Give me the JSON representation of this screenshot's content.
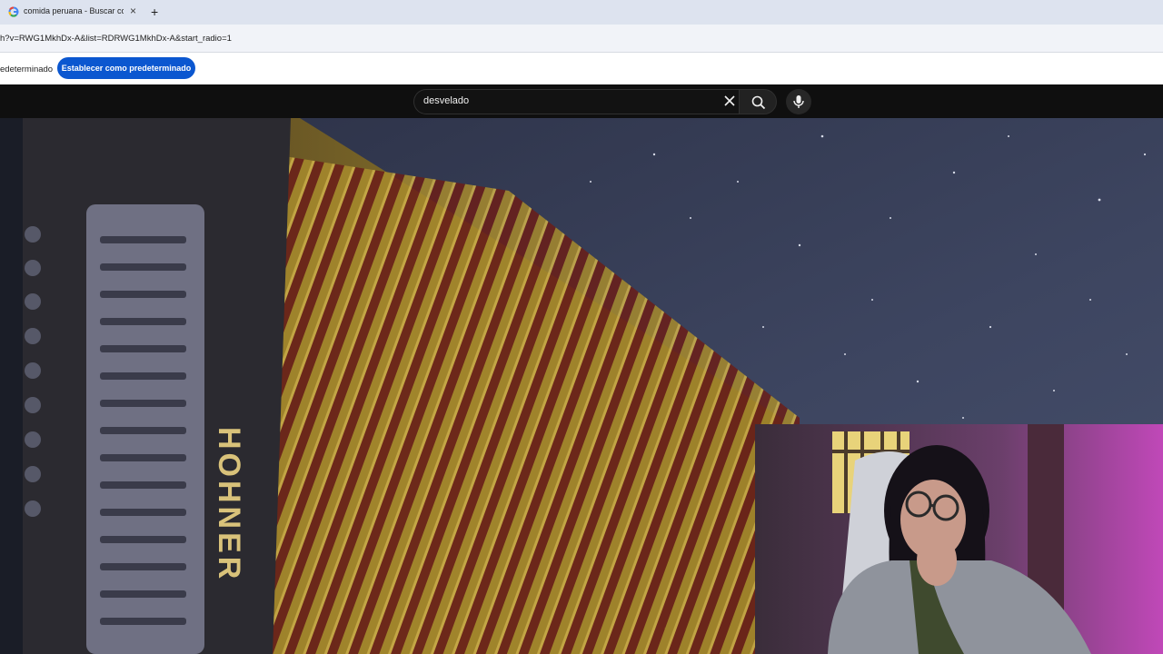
{
  "browser": {
    "tab_title": "comida peruana - Buscar con G",
    "tab_close": "×",
    "new_tab": "+",
    "url": "h?v=RWG1MkhDx-A&list=RDRWG1MkhDx-A&start_radio=1"
  },
  "infobar": {
    "text": "edeterminado",
    "button": "Establecer como predeterminado"
  },
  "youtube": {
    "search_value": "desvelado",
    "video_brand_text": "HOHNER"
  },
  "colors": {
    "accent": "#0b57d0",
    "youtube_bg": "#0f0f0f"
  }
}
